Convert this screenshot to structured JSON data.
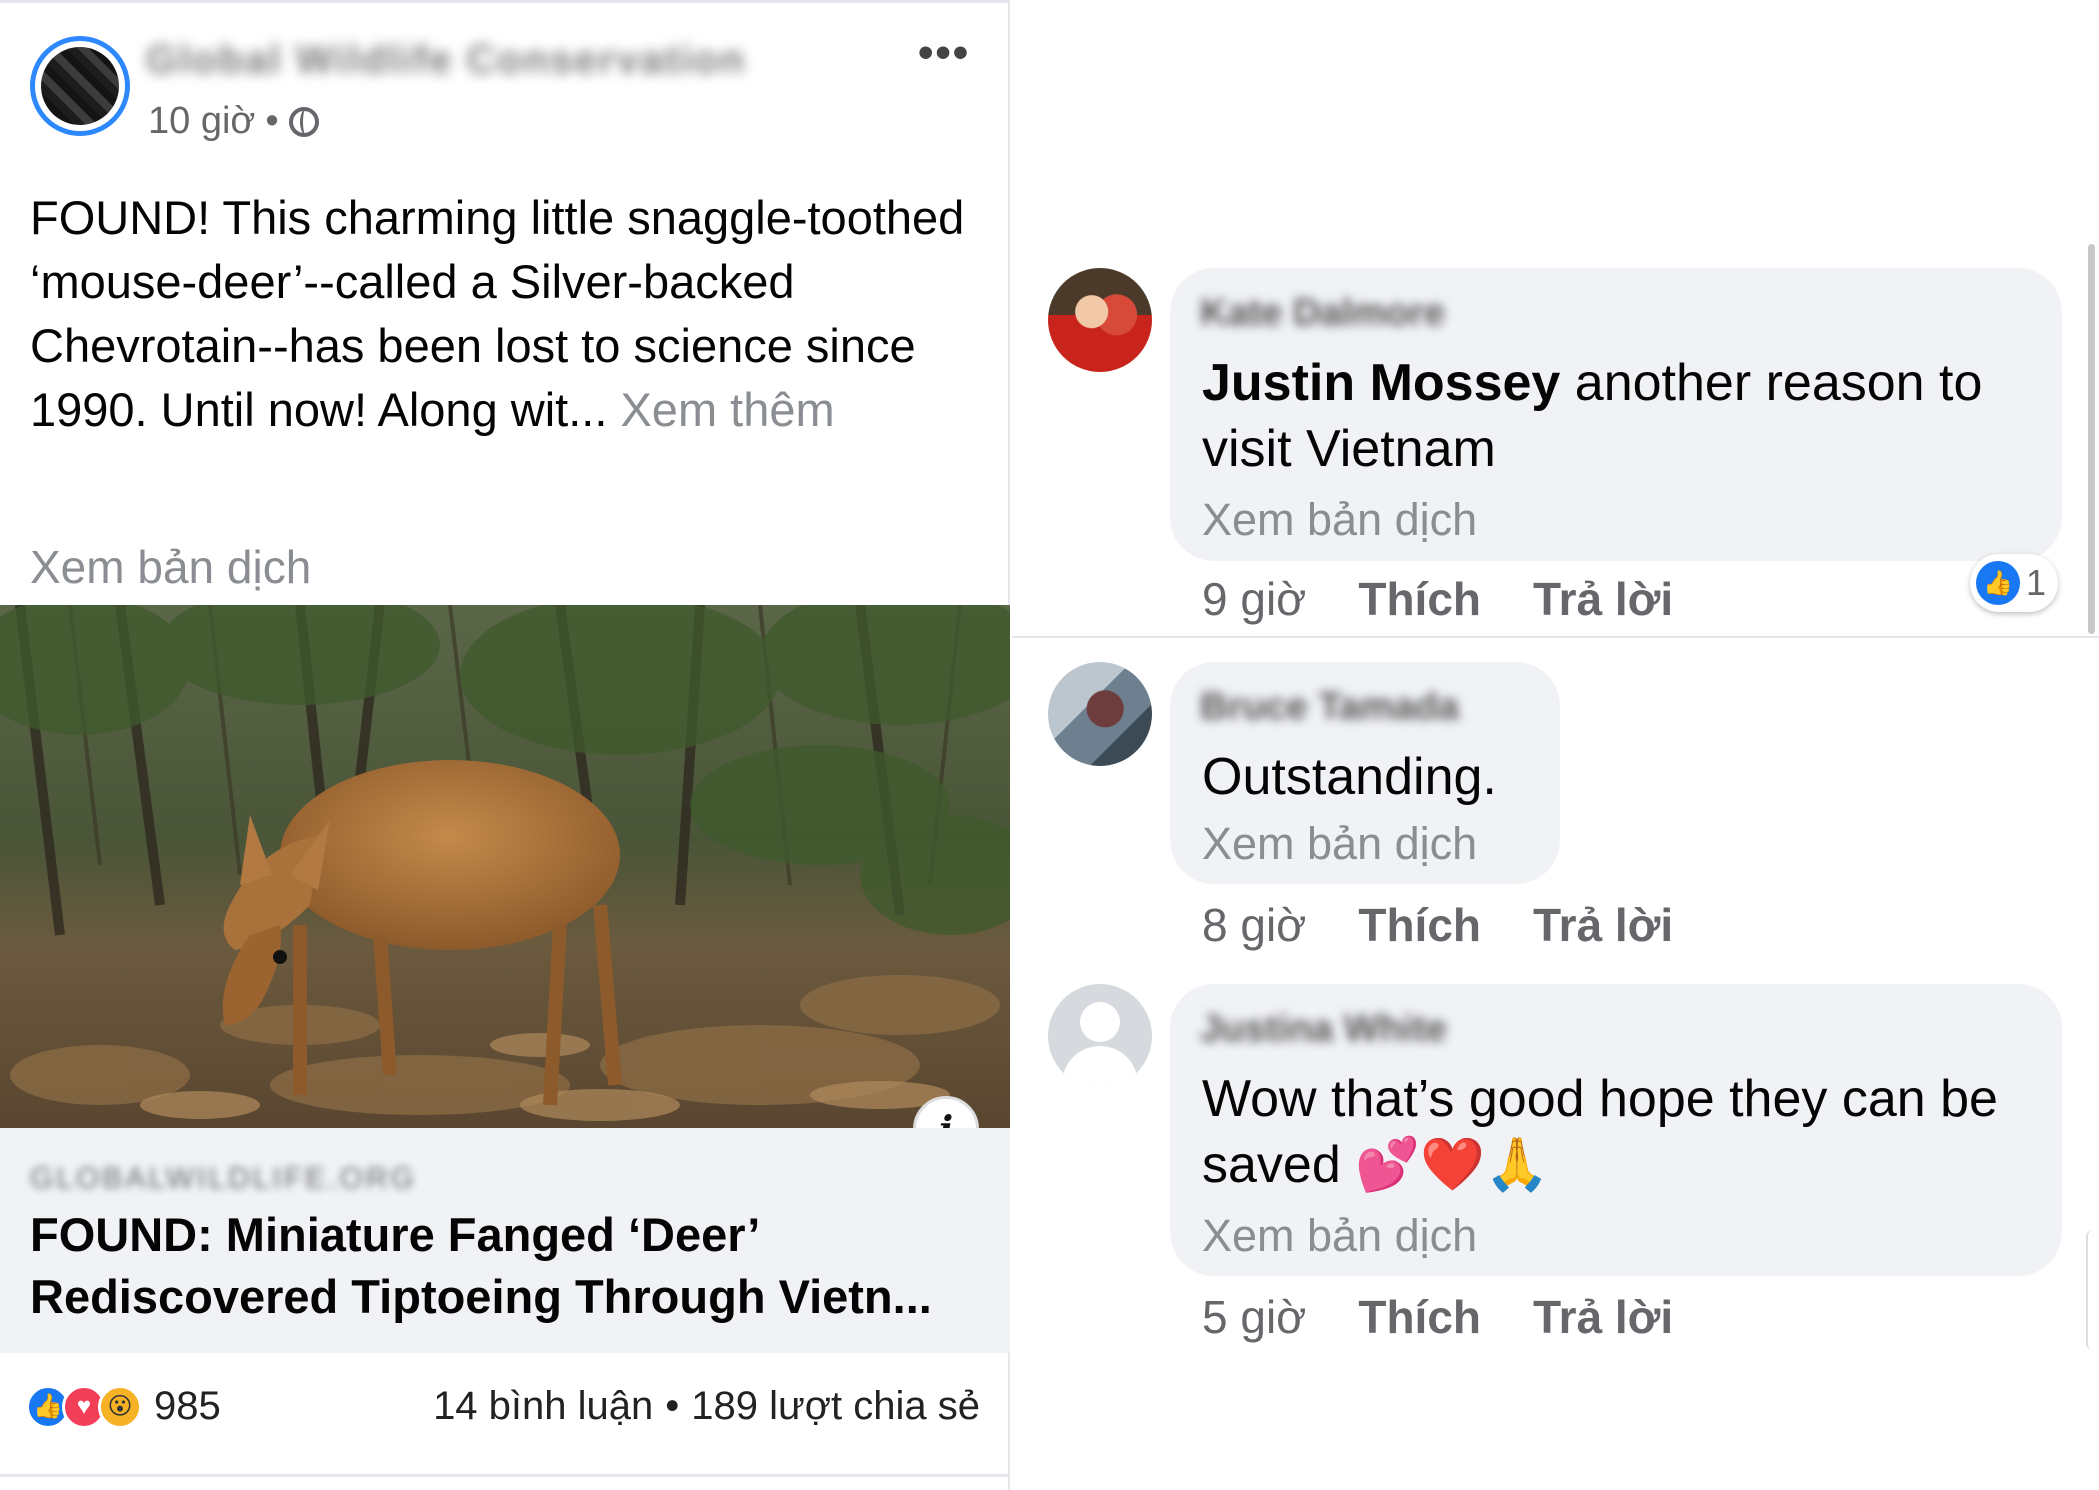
{
  "post": {
    "page_name": "Global Wildlife Conservation",
    "time": "10 giờ",
    "meta_separator": "•",
    "more_label": "•••",
    "text": "FOUND! This charming little snaggle-toothed ‘mouse-deer’--called a Silver-backed Chevrotain--has been lost to science since 1990. Until now! Along wit...",
    "see_more": "Xem thêm",
    "translate": "Xem bản dịch",
    "info_icon": "i",
    "link": {
      "domain": "GLOBALWILDLIFE.ORG",
      "title": "FOUND: Miniature Fanged ‘Deer’ Rediscovered Tiptoeing Through Vietn..."
    },
    "reactions": {
      "icons": [
        "like-icon",
        "love-icon",
        "wow-icon"
      ],
      "count": "985"
    },
    "comments_count": "14 bình luận",
    "stats_separator": "•",
    "shares_count": "189 lượt chia sẻ"
  },
  "comments": [
    {
      "author": "Kate Dalmore",
      "mention": "Justin Mossey",
      "text": " another reason to visit Vietnam",
      "translate": "Xem bản dịch",
      "time": "9 giờ",
      "like_label": "Thích",
      "reply_label": "Trả lời",
      "reaction_count": "1"
    },
    {
      "author": "Bruce Tamada",
      "text": "Outstanding.",
      "translate": "Xem bản dịch",
      "time": "8 giờ",
      "like_label": "Thích",
      "reply_label": "Trả lời"
    },
    {
      "author": "Justina White",
      "text": "Wow that’s good hope they can be saved 💕❤️🙏",
      "translate": "Xem bản dịch",
      "time": "5 giờ",
      "like_label": "Thích",
      "reply_label": "Trả lời"
    }
  ],
  "colors": {
    "brand_blue": "#1877f2",
    "bubble_bg": "#f0f2f5",
    "muted_text": "#65676b"
  }
}
